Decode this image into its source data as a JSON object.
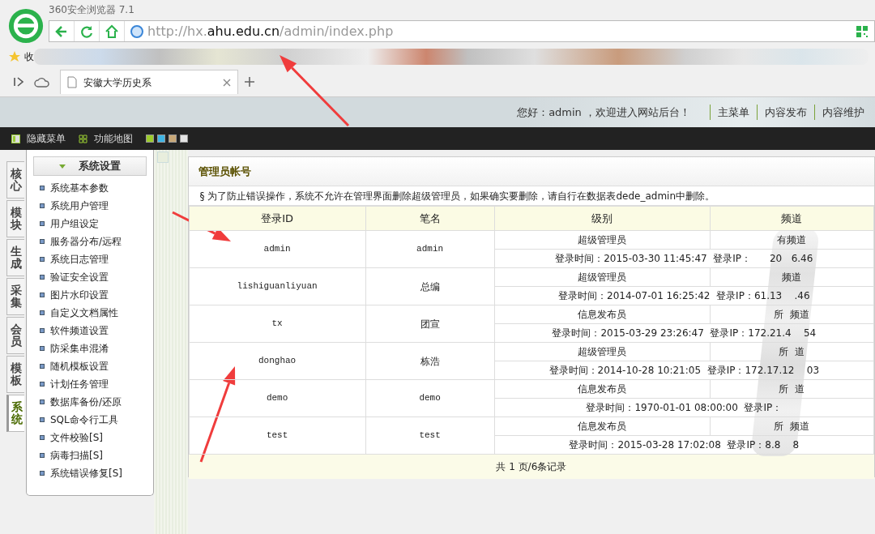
{
  "browser": {
    "title": "360安全浏览器 7.1",
    "url": {
      "prefix": "http://hx.",
      "domain": "ahu.edu.cn",
      "path": "/admin/index.php"
    },
    "bookmarks_label": "收",
    "tab": {
      "title": "安徽大学历史系"
    }
  },
  "header": {
    "greeting": "您好：admin ，欢迎进入网站后台！",
    "links": [
      "主菜单",
      "内容发布",
      "内容维护"
    ]
  },
  "toolbar": {
    "items": [
      "隐藏菜单",
      "功能地图"
    ],
    "swatches": [
      {
        "color": "#9ccc2c"
      },
      {
        "color": "#3fb4e4"
      },
      {
        "color": "#c8a878"
      },
      {
        "color": "#e4e4e4"
      }
    ]
  },
  "side_tabs": [
    {
      "label": "核心",
      "selected": false
    },
    {
      "label": "模块",
      "selected": false
    },
    {
      "label": "生成",
      "selected": false
    },
    {
      "label": "采集",
      "selected": false
    },
    {
      "label": "会员",
      "selected": false
    },
    {
      "label": "模板",
      "selected": false
    },
    {
      "label": "系统",
      "selected": true
    }
  ],
  "menu": {
    "title": "系统设置",
    "items": [
      "系统基本参数",
      "系统用户管理",
      "用户组设定",
      "服务器分布/远程",
      "系统日志管理",
      "验证安全设置",
      "图片水印设置",
      "自定义文档属性",
      "软件频道设置",
      "防采集串混淆",
      "随机模板设置",
      "计划任务管理",
      "数据库备份/还原",
      "SQL命令行工具",
      "文件校验[S]",
      "病毒扫描[S]",
      "系统错误修复[S]"
    ]
  },
  "panel": {
    "title": "管理员帐号",
    "notice": "§ 为了防止错误操作，系统不允许在管理界面删除超级管理员，如果确实要删除，请自行在数据表dede_admin中删除。",
    "table": {
      "columns": [
        "登录ID",
        "笔名",
        "级别",
        "频道"
      ],
      "rows": [
        {
          "login_id": "admin",
          "pen_name": "admin",
          "level": "超级管理员",
          "channel": "有频道",
          "login_info": "登录时间：2015-03-30 11:45:47  登录IP：      20   6.46"
        },
        {
          "login_id": "lishiguanliyuan",
          "pen_name": "总编",
          "level": "超级管理员",
          "channel": "频道",
          "login_info": "登录时间：2014-07-01 16:25:42  登录IP：61.13    .46"
        },
        {
          "login_id": "tx",
          "pen_name": "团宣",
          "level": "信息发布员",
          "channel": "所  频道",
          "login_info": "登录时间：2015-03-29 23:26:47  登录IP：172.21.4    54"
        },
        {
          "login_id": "donghao",
          "pen_name": "栋浩",
          "level": "超级管理员",
          "channel": "所  道",
          "login_info": "登录时间：2014-10-28 10:21:05  登录IP：172.17.12    03"
        },
        {
          "login_id": "demo",
          "pen_name": "demo",
          "level": "信息发布员",
          "channel": "所  道",
          "login_info": "登录时间：1970-01-01 08:00:00  登录IP："
        },
        {
          "login_id": "test",
          "pen_name": "test",
          "level": "信息发布员",
          "channel": "所  频道",
          "login_info": "登录时间：2015-03-28 17:02:08  登录IP：8.8    8"
        }
      ]
    },
    "footer": "共 1 页/6条记录"
  }
}
